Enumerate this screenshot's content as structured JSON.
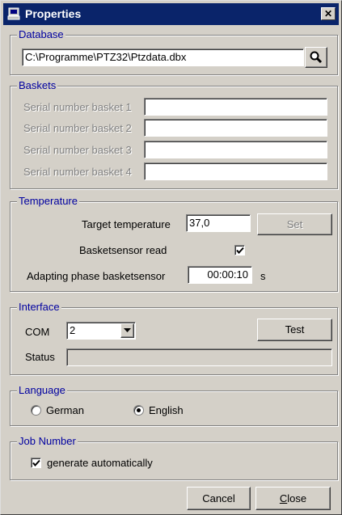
{
  "window": {
    "title": "Properties",
    "close_glyph": "✕",
    "icon": "computer-icon"
  },
  "database": {
    "group_label": "Database",
    "path_value": "C:\\Programme\\PTZ32\\Ptzdata.dbx",
    "browse_icon": "magnifier-icon"
  },
  "baskets": {
    "group_label": "Baskets",
    "items": [
      {
        "label": "Serial number basket 1",
        "value": ""
      },
      {
        "label": "Serial number basket 2",
        "value": ""
      },
      {
        "label": "Serial number basket 3",
        "value": ""
      },
      {
        "label": "Serial number basket 4",
        "value": ""
      }
    ]
  },
  "temperature": {
    "group_label": "Temperature",
    "target_label": "Target temperature",
    "target_value": "37,0",
    "set_label": "Set",
    "basketsensor_label": "Basketsensor read",
    "basketsensor_checked": true,
    "adapting_label": "Adapting phase basketsensor",
    "adapting_value": "00:00:10",
    "adapting_unit": "s"
  },
  "interface": {
    "group_label": "Interface",
    "com_label": "COM",
    "com_value": "2",
    "test_label": "Test",
    "status_label": "Status",
    "status_value": ""
  },
  "language": {
    "group_label": "Language",
    "options": [
      "German",
      "English"
    ],
    "selected": "English"
  },
  "job_number": {
    "group_label": "Job Number",
    "auto_label": "generate automatically",
    "auto_checked": true
  },
  "footer": {
    "cancel_label": "Cancel",
    "close_label_rest": "lose",
    "close_label_mnemonic": "C"
  }
}
